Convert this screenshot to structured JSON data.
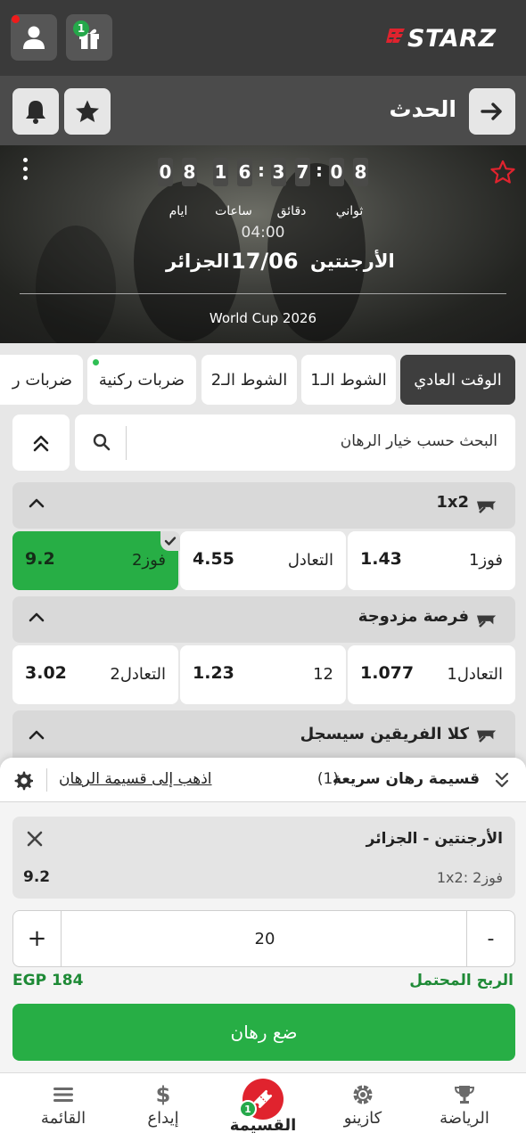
{
  "brand": {
    "logo_text": "STARZ"
  },
  "header": {
    "gift_badge": "1",
    "icons": [
      "user-icon",
      "gift-icon"
    ]
  },
  "subheader": {
    "title": "الحدث",
    "icons": [
      "arrow-right-icon",
      "star-icon",
      "bell-icon"
    ]
  },
  "event": {
    "countdown": {
      "days": [
        "0",
        "8"
      ],
      "days_label": "ايام",
      "hours": [
        "1",
        "6"
      ],
      "hours_label": "ساعات",
      "minutes": [
        "3",
        "7"
      ],
      "minutes_label": "دقائق",
      "seconds": [
        "0",
        "8"
      ],
      "seconds_label": "ثواني"
    },
    "time": "04:00",
    "team_home": "الأرجنتين",
    "date": "17/06",
    "team_away": "الجزائر",
    "league": "World Cup 2026"
  },
  "tabs": [
    {
      "label": "الوقت العادي",
      "active": true
    },
    {
      "label": "الشوط الـ1"
    },
    {
      "label": "الشوط الـ2"
    },
    {
      "label": "ضربات ركنية"
    },
    {
      "label": "ضربات ر"
    }
  ],
  "search": {
    "placeholder": "البحث حسب خيار الرهان"
  },
  "markets": [
    {
      "title": "1x2",
      "odds": [
        {
          "label": "فوز1",
          "value": "1.43"
        },
        {
          "label": "التعادل",
          "value": "4.55"
        },
        {
          "label": "فوز2",
          "value": "9.2",
          "selected": true
        }
      ]
    },
    {
      "title": "فرصة مزدوجة",
      "odds": [
        {
          "label": "1التعادل",
          "value": "1.077"
        },
        {
          "label": "12",
          "value": "1.23"
        },
        {
          "label": "2التعادل",
          "value": "3.02"
        }
      ]
    },
    {
      "title": "كلا الفريقين سيسجل"
    }
  ],
  "quick_slip": {
    "title": "قسيمة رهان سريعة",
    "count": "(1)",
    "go_link": "اذهب إلى قسيمة الرهان",
    "bet": {
      "teams": "الأرجنتين - الجزائر",
      "selection": "1x2: فوز2",
      "odd": "9.2"
    },
    "stake": "20",
    "minus": "-",
    "plus": "+",
    "potential_label": "الربح المحتمل",
    "potential_value": "EGP 184",
    "place_label": "ضع رهان"
  },
  "bottom_nav": [
    {
      "label": "الرياضة",
      "icon": "trophy-icon"
    },
    {
      "label": "كازينو",
      "icon": "casino-chip-icon"
    },
    {
      "label": "القسيمة",
      "icon": "ticket-icon",
      "badge": "1",
      "active": true
    },
    {
      "label": "إيداع",
      "icon": "dollar-icon"
    },
    {
      "label": "القائمة",
      "icon": "menu-icon"
    }
  ],
  "colors": {
    "accent_green": "#27ae45",
    "brand_red": "#e0232e",
    "header_dark": "#3a3a3a"
  }
}
